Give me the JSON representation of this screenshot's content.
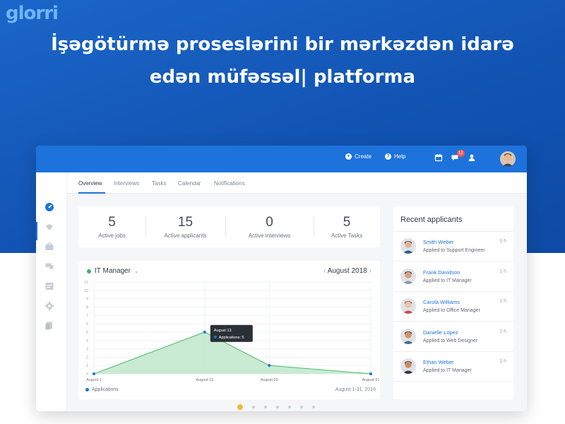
{
  "brand": {
    "logo_text": "glorri"
  },
  "headline": {
    "line1": "İşəgötürmə proseslərini bir mərkəzdən idarə",
    "line2": "edən müfəssəl| platforma"
  },
  "topbar": {
    "create_label": "Create",
    "help_label": "Help",
    "messages_badge": "12",
    "icons": [
      "calendar-icon",
      "chat-icon",
      "user-icon"
    ]
  },
  "tabs": [
    {
      "label": "Overview",
      "active": true
    },
    {
      "label": "Interviews",
      "active": false
    },
    {
      "label": "Tasks",
      "active": false
    },
    {
      "label": "Calendar",
      "active": false
    },
    {
      "label": "Notifications",
      "active": false
    }
  ],
  "stats": [
    {
      "value": "5",
      "label": "Active jobs"
    },
    {
      "value": "15",
      "label": "Active applicants"
    },
    {
      "value": "0",
      "label": "Active interviews"
    },
    {
      "value": "5",
      "label": "Active Tasks"
    }
  ],
  "chart_panel": {
    "job_selector": "IT Manager",
    "month": "August 2018",
    "legend": "Applications",
    "range": "August 1-31, 2018",
    "tooltip_title": "August 13",
    "tooltip_value": "Applications: 5"
  },
  "chart_data": {
    "type": "area",
    "x": [
      "August 1",
      "August 13",
      "August 20",
      "August 31"
    ],
    "series": [
      {
        "name": "Applications",
        "values": [
          0,
          5,
          1,
          0
        ]
      }
    ],
    "yticks": [
      0,
      1,
      2,
      3,
      4,
      5,
      6,
      7,
      8,
      9,
      10,
      11
    ],
    "ylim": [
      0,
      11
    ],
    "grid": true,
    "legend_position": "bottom-left",
    "colors": {
      "fill": "#bfe6cb",
      "line": "#5cc07a",
      "point": "#1d72dc"
    }
  },
  "recent_applicants": {
    "title": "Recent applicants",
    "items": [
      {
        "name": "Smith Weber",
        "role": "Applied to Support Engineer",
        "time": "1 h"
      },
      {
        "name": "Frank Davidson",
        "role": "Applied to IT Manager",
        "time": "1 h"
      },
      {
        "name": "Carola Williams",
        "role": "Applied to Office Manager",
        "time": "1 h"
      },
      {
        "name": "Danielle Lopez",
        "role": "Applied to Web Designer",
        "time": "1 h"
      },
      {
        "name": "Ethan Weber",
        "role": "Applied to IT Manager",
        "time": "1 h"
      }
    ]
  },
  "colors": {
    "brand_blue": "#1d72dc",
    "hero_blue": "#1254b3",
    "accent_orange": "#f5b53f",
    "badge_red": "#ff5a4a"
  }
}
